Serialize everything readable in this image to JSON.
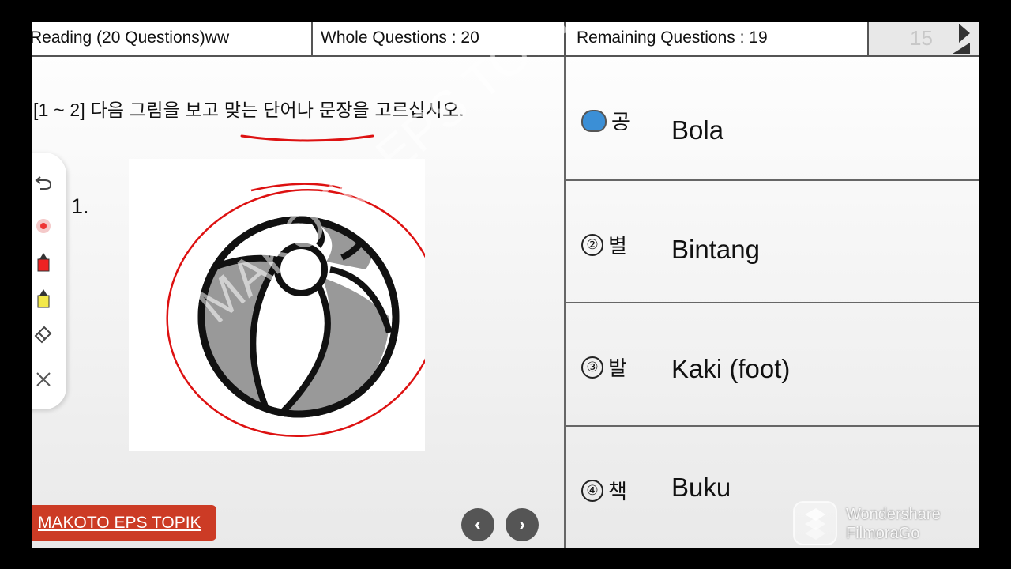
{
  "header": {
    "reading": "Reading (20 Questions)ww",
    "whole": "Whole Questions : 20",
    "remaining": "Remaining Questions : 19",
    "timer_faded": "15"
  },
  "question": {
    "instruction": "[1 ~ 2] 다음 그림을 보고 맞는 단어나 문장을 고르십시오.",
    "number": "1.",
    "image": "beach-ball"
  },
  "toolbar": [
    "undo-icon",
    "pen-dot-icon",
    "red-marker-icon",
    "yellow-highlighter-icon",
    "eraser-icon",
    "close-icon"
  ],
  "answers": [
    {
      "marker": "",
      "korean": "공",
      "text": "Bola",
      "selected": true
    },
    {
      "marker": "②",
      "korean": "별",
      "text": "Bintang",
      "selected": false
    },
    {
      "marker": "③",
      "korean": "발",
      "text": "Kaki (foot)",
      "selected": false
    },
    {
      "marker": "④",
      "korean": "책",
      "text": "Buku",
      "selected": false
    }
  ],
  "brand": "MAKOTO EPS TOPIK",
  "nav": {
    "prev": "‹",
    "next": "›"
  },
  "watermark": "MAKOTO EPS TOPIK",
  "overlay": {
    "line1": "Wondershare",
    "line2": "FilmoraGo"
  },
  "colors": {
    "accent_red": "#cc3b25",
    "selected_blue": "#3b8fd6",
    "annotation_red": "#d11"
  }
}
